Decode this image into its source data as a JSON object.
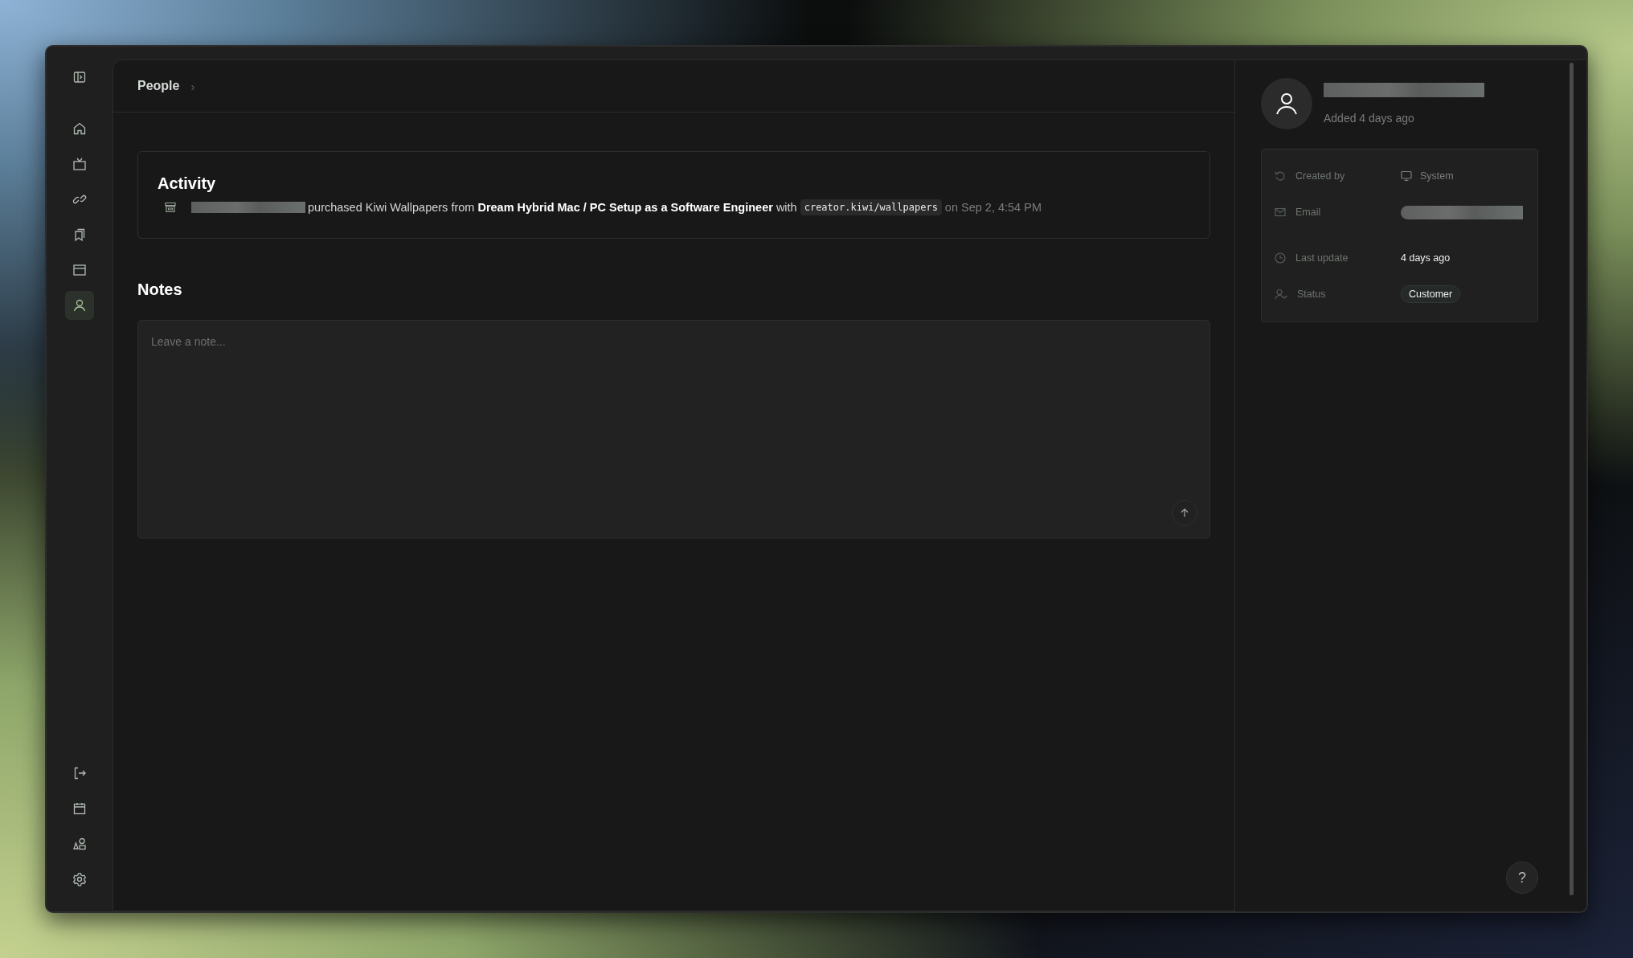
{
  "sidebar": {
    "top_items": [
      {
        "selected": false
      },
      {
        "selected": false
      },
      {
        "selected": false
      },
      {
        "selected": false
      },
      {
        "selected": false
      },
      {
        "selected": true
      }
    ],
    "bottom_items": [
      {
        "selected": false
      },
      {
        "selected": false
      },
      {
        "selected": false
      },
      {
        "selected": false
      }
    ]
  },
  "breadcrumb": {
    "label": "People",
    "separator": "›"
  },
  "activity": {
    "title": "Activity",
    "text": "purchased Kiwi Wallpapers from **Dream Hybrid Mac / PC Setup as a Software Engineer** with",
    "link": "creator.kiwi/wallpapers",
    "time": "on Sep 2, 4:54 PM"
  },
  "notes": {
    "title": "Notes",
    "placeholder": "Leave a note..."
  },
  "profile": {
    "added": "Added 4 days ago"
  },
  "details": [
    {
      "kind": "icon-text",
      "label": "Created by",
      "value": "System"
    },
    {
      "kind": "redacted",
      "label": "Email"
    },
    {
      "kind": "text",
      "label": "Last update",
      "value": "4 days ago"
    },
    {
      "kind": "badge",
      "label": "Status",
      "value": "Customer"
    }
  ],
  "help": {
    "label": "?"
  }
}
